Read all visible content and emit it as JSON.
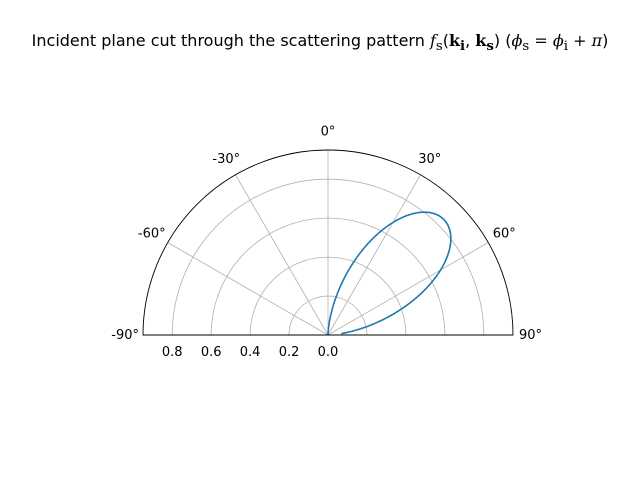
{
  "chart_data": {
    "type": "line",
    "projection": "polar-half (top)",
    "title": {
      "prefix": "Incident plane cut through the scattering pattern ",
      "f": "f",
      "f_sub": "s",
      "open": "(",
      "k": "k",
      "sub_i": "i",
      "comma": ", ",
      "sub_s": "s",
      "close": ")",
      "phi_s": "ϕ",
      "equals": " = ",
      "phi_i": "ϕ",
      "plus": " + ",
      "pi": "π"
    },
    "theta_ticks": [
      {
        "deg": -90,
        "label": "-90°"
      },
      {
        "deg": -60,
        "label": "-60°"
      },
      {
        "deg": -30,
        "label": "-30°"
      },
      {
        "deg": 0,
        "label": "0°"
      },
      {
        "deg": 30,
        "label": "30°"
      },
      {
        "deg": 60,
        "label": "60°"
      },
      {
        "deg": 90,
        "label": "90°"
      }
    ],
    "theta_range_deg": [
      -90,
      90
    ],
    "r_range": [
      0,
      0.95
    ],
    "r_ticks": [
      {
        "value": 0.8,
        "label": "0.8"
      },
      {
        "value": 0.6,
        "label": "0.6"
      },
      {
        "value": 0.4,
        "label": "0.4"
      },
      {
        "value": 0.2,
        "label": "0.2"
      },
      {
        "value": 0.0,
        "label": "0.0"
      }
    ],
    "grid": true,
    "series": [
      {
        "color": "#1f77b4",
        "lobe": {
          "center_deg": 45,
          "width_deg": 45,
          "peak_r": 0.84,
          "theta_max_deg": 84
        }
      }
    ]
  }
}
